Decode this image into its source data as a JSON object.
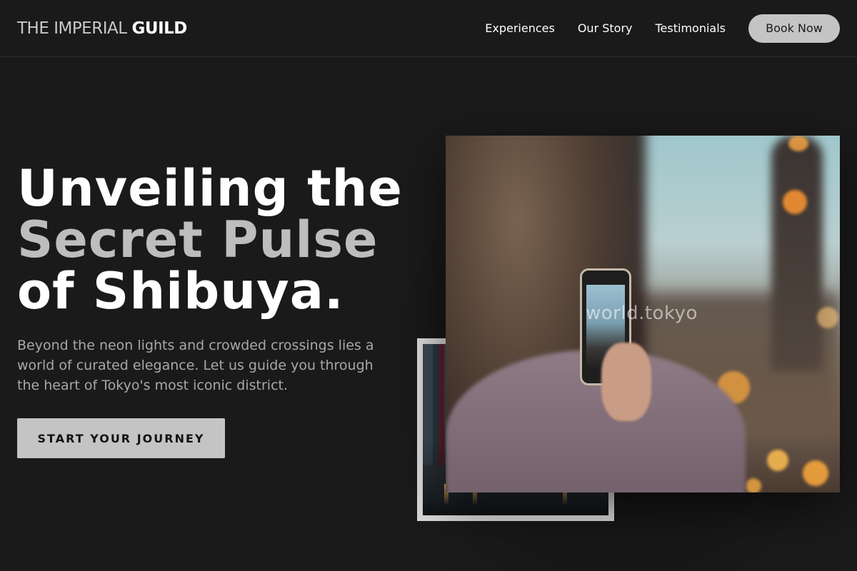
{
  "nav": {
    "logo_light": "THE IMPERIAL",
    "logo_bold": "GUILD",
    "links": [
      "Experiences",
      "Our Story",
      "Testimonials"
    ],
    "book_label": "Book Now"
  },
  "hero": {
    "line1": "Unveiling the",
    "line2": "Secret Pulse",
    "line3": "of Shibuya.",
    "subtext": "Beyond the neon lights and crowded crossings lies a world of curated elegance. Let us guide you through the heart of Tokyo's most iconic district.",
    "cta_label": "START YOUR JOURNEY"
  },
  "photo": {
    "watermark": "world.tokyo"
  },
  "colors": {
    "background": "#1a1a1a",
    "accent_button": "#c4c4c4",
    "muted_heading": "#bdbdbd",
    "body_text": "#a8a8a8"
  }
}
